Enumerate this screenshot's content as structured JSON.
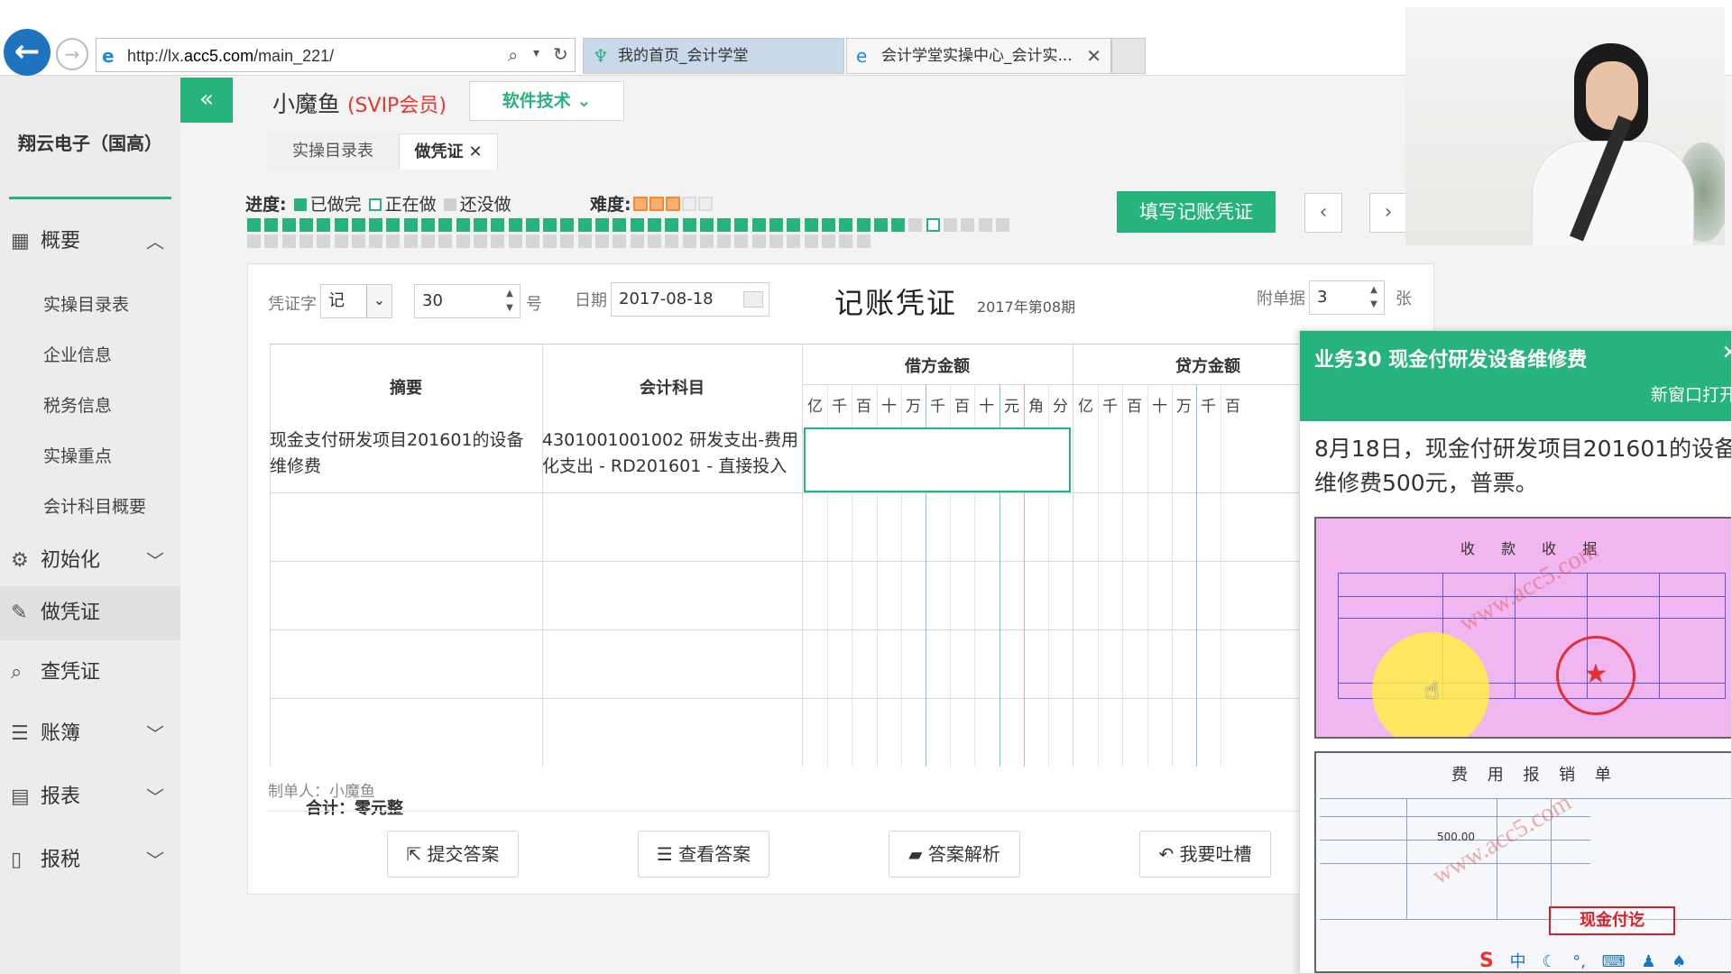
{
  "browser": {
    "url_prefix": "http://lx.",
    "url_domain": "acc5.com",
    "url_path": "/main_221/",
    "tabs": [
      {
        "label": "我的首页_会计学堂"
      },
      {
        "label": "会计学堂实操中心_会计实..."
      }
    ]
  },
  "sidebar": {
    "company": "翔云电子（国高）",
    "items": [
      {
        "label": "概要",
        "icon": "grid-icon",
        "expanded": true
      },
      {
        "label": "初始化",
        "icon": "gear-icon"
      },
      {
        "label": "做凭证",
        "icon": "pencil-icon",
        "active": true
      },
      {
        "label": "查凭证",
        "icon": "search-icon"
      },
      {
        "label": "账簿",
        "icon": "book-icon"
      },
      {
        "label": "报表",
        "icon": "report-icon"
      },
      {
        "label": "报税",
        "icon": "file-icon"
      }
    ],
    "subitems": [
      "实操目录表",
      "企业信息",
      "税务信息",
      "实操重点",
      "会计科目概要"
    ]
  },
  "header": {
    "user_name": "小魔鱼",
    "vip_label": "(SVIP会员)",
    "software_btn": "软件技术",
    "tabs": [
      {
        "label": "实操目录表"
      },
      {
        "label": "做凭证",
        "active": true
      }
    ]
  },
  "progress": {
    "label": "进度:",
    "done_label": "已做完",
    "doing_label": "正在做",
    "todo_label": "还没做",
    "difficulty_label": "难度:",
    "difficulty": 3,
    "difficulty_max": 5,
    "done_count": 38,
    "current_index": 39,
    "total_count": 80
  },
  "fill_button": "填写记账凭证",
  "voucher": {
    "word_label": "凭证字",
    "word_value": "记",
    "number": "30",
    "number_unit": "号",
    "date_label": "日期",
    "date": "2017-08-18",
    "title": "记账凭证",
    "period": "2017年第08期",
    "attach_label": "附单据",
    "attach_count": "3",
    "attach_unit": "张",
    "headers": {
      "summary": "摘要",
      "account": "会计科目",
      "debit": "借方金额",
      "credit": "贷方金额"
    },
    "digits": [
      "亿",
      "千",
      "百",
      "十",
      "万",
      "千",
      "百",
      "十",
      "元",
      "角",
      "分"
    ],
    "credit_digits": [
      "亿",
      "千",
      "百",
      "十",
      "万",
      "千",
      "百"
    ],
    "rows": [
      {
        "summary": "现金支付研发项目201601的设备维修费",
        "account": "4301001001002 研发支出-费用化支出 - RD201601 - 直接投入"
      }
    ],
    "total": "合计：零元整",
    "maker": "制单人：小魔鱼"
  },
  "actions": [
    {
      "label": "提交答案",
      "icon": "external-link-icon"
    },
    {
      "label": "查看答案",
      "icon": "database-icon"
    },
    {
      "label": "答案解析",
      "icon": "folder-icon"
    },
    {
      "label": "我要吐槽",
      "icon": "reply-icon"
    }
  ],
  "task": {
    "title": "业务30 现金付研发设备维修费",
    "new_window": "新窗口打开",
    "description": "8月18日，现金付研发项目201601的设备维修费500元，普票。",
    "receipt1_title": "收 款 收 据",
    "receipt2_title": "费 用 报 销 单",
    "receipt2_amount": "500.00",
    "receipt2_stamp": "现金付讫",
    "watermark": "www.acc5.com"
  },
  "colors": {
    "accent": "#27b37c",
    "vip": "#e8362c",
    "browser_back": "#1e73be"
  }
}
